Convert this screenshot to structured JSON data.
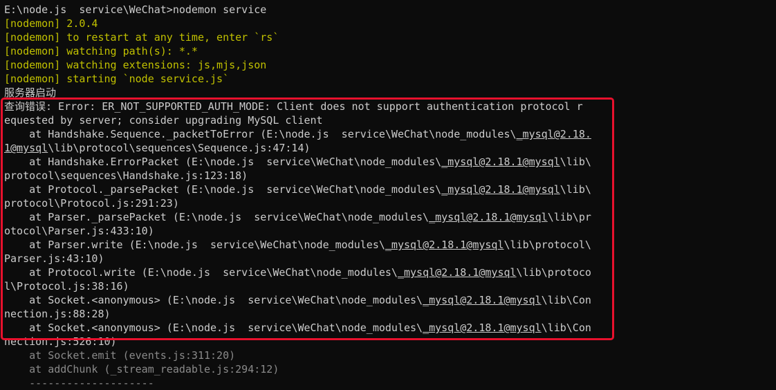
{
  "lines": [
    {
      "style": "",
      "parts": [
        {
          "t": "E:\\node.js  service\\WeChat>nodemon service"
        }
      ]
    },
    {
      "style": "yellow",
      "parts": [
        {
          "t": "[nodemon] 2.0.4"
        }
      ]
    },
    {
      "style": "yellow",
      "parts": [
        {
          "t": "[nodemon] to restart at any time, enter `rs`"
        }
      ]
    },
    {
      "style": "yellow",
      "parts": [
        {
          "t": "[nodemon] watching path(s): *.*"
        }
      ]
    },
    {
      "style": "yellow",
      "parts": [
        {
          "t": "[nodemon] watching extensions: js,mjs,json"
        }
      ]
    },
    {
      "style": "yellow",
      "parts": [
        {
          "t": "[nodemon] starting `node service.js`"
        }
      ]
    },
    {
      "style": "",
      "parts": [
        {
          "t": "服务器启动"
        }
      ]
    },
    {
      "style": "",
      "parts": [
        {
          "t": "查询错误: Error: ER_NOT_SUPPORTED_AUTH_MODE: Client does not support authentication protocol r"
        }
      ]
    },
    {
      "style": "",
      "parts": [
        {
          "t": "equested by server; consider upgrading MySQL client"
        }
      ]
    },
    {
      "style": "",
      "parts": [
        {
          "t": "    at Handshake.Sequence._packetToError (E:\\node.js  service\\WeChat\\node_modules\\"
        },
        {
          "t": "_mysql@2.18.",
          "u": true
        }
      ]
    },
    {
      "style": "",
      "parts": [
        {
          "t": "1@mysql",
          "u": true
        },
        {
          "t": "\\lib\\protocol\\sequences\\Sequence.js:47:14)"
        }
      ]
    },
    {
      "style": "",
      "parts": [
        {
          "t": "    at Handshake.ErrorPacket (E:\\node.js  service\\WeChat\\node_modules\\"
        },
        {
          "t": "_mysql@2.18.1@mysql",
          "u": true
        },
        {
          "t": "\\lib\\"
        }
      ]
    },
    {
      "style": "",
      "parts": [
        {
          "t": "protocol\\sequences\\Handshake.js:123:18)"
        }
      ]
    },
    {
      "style": "",
      "parts": [
        {
          "t": "    at Protocol._parsePacket (E:\\node.js  service\\WeChat\\node_modules\\"
        },
        {
          "t": "_mysql@2.18.1@mysql",
          "u": true
        },
        {
          "t": "\\lib\\"
        }
      ]
    },
    {
      "style": "",
      "parts": [
        {
          "t": "protocol\\Protocol.js:291:23)"
        }
      ]
    },
    {
      "style": "",
      "parts": [
        {
          "t": "    at Parser._parsePacket (E:\\node.js  service\\WeChat\\node_modules\\"
        },
        {
          "t": "_mysql@2.18.1@mysql",
          "u": true
        },
        {
          "t": "\\lib\\pr"
        }
      ]
    },
    {
      "style": "",
      "parts": [
        {
          "t": "otocol\\Parser.js:433:10)"
        }
      ]
    },
    {
      "style": "",
      "parts": [
        {
          "t": "    at Parser.write (E:\\node.js  service\\WeChat\\node_modules\\"
        },
        {
          "t": "_mysql@2.18.1@mysql",
          "u": true
        },
        {
          "t": "\\lib\\protocol\\"
        }
      ]
    },
    {
      "style": "",
      "parts": [
        {
          "t": "Parser.js:43:10)"
        }
      ]
    },
    {
      "style": "",
      "parts": [
        {
          "t": "    at Protocol.write (E:\\node.js  service\\WeChat\\node_modules\\"
        },
        {
          "t": "_mysql@2.18.1@mysql",
          "u": true
        },
        {
          "t": "\\lib\\protoco"
        }
      ]
    },
    {
      "style": "",
      "parts": [
        {
          "t": "l\\Protocol.js:38:16)"
        }
      ]
    },
    {
      "style": "",
      "parts": [
        {
          "t": "    at Socket.<anonymous> (E:\\node.js  service\\WeChat\\node_modules\\"
        },
        {
          "t": "_mysql@2.18.1@mysql",
          "u": true
        },
        {
          "t": "\\lib\\Con"
        }
      ]
    },
    {
      "style": "",
      "parts": [
        {
          "t": "nection.js:88:28)"
        }
      ]
    },
    {
      "style": "",
      "parts": [
        {
          "t": "    at Socket.<anonymous> (E:\\node.js  service\\WeChat\\node_modules\\"
        },
        {
          "t": "_mysql@2.18.1@mysql",
          "u": true
        },
        {
          "t": "\\lib\\Con"
        }
      ]
    },
    {
      "style": "",
      "parts": [
        {
          "t": "nection.js:526:10)"
        }
      ]
    },
    {
      "style": "dim",
      "parts": [
        {
          "t": "    at Socket.emit (events.js:311:20)"
        }
      ]
    },
    {
      "style": "dim",
      "parts": [
        {
          "t": "    at addChunk (_stream_readable.js:294:12)"
        }
      ]
    },
    {
      "style": "dim",
      "parts": [
        {
          "t": "    --------------------"
        }
      ]
    }
  ],
  "colors": {
    "background": "#0c0c0c",
    "text": "#cccccc",
    "nodemon_yellow": "#c1c100",
    "highlight_box": "#e8112d"
  }
}
